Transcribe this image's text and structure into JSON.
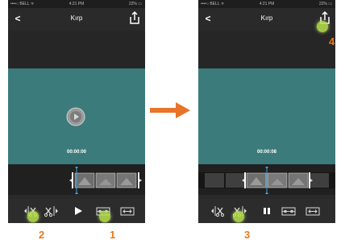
{
  "status": {
    "carrier": "••••○ BELL ᯤ",
    "time": "4:21 PM",
    "battery": "22% ▭"
  },
  "screens": [
    {
      "title": "Kırp",
      "timecode": "00:00:00"
    },
    {
      "title": "Kırp",
      "timecode": "00:00:08"
    }
  ],
  "callouts": {
    "one": "1",
    "two": "2",
    "three": "3",
    "four": "4"
  },
  "colors": {
    "video_bg": "#3c7b7b",
    "arrow": "#e8742a",
    "callout": "#e87a1b",
    "selection": "#4aa3d8"
  },
  "icons": [
    "back-icon",
    "share-icon",
    "play-icon",
    "pause-icon",
    "scissors-icon",
    "trim-left-icon",
    "trim-right-icon",
    "split-icon",
    "duplicate-icon",
    "frame-icon"
  ]
}
